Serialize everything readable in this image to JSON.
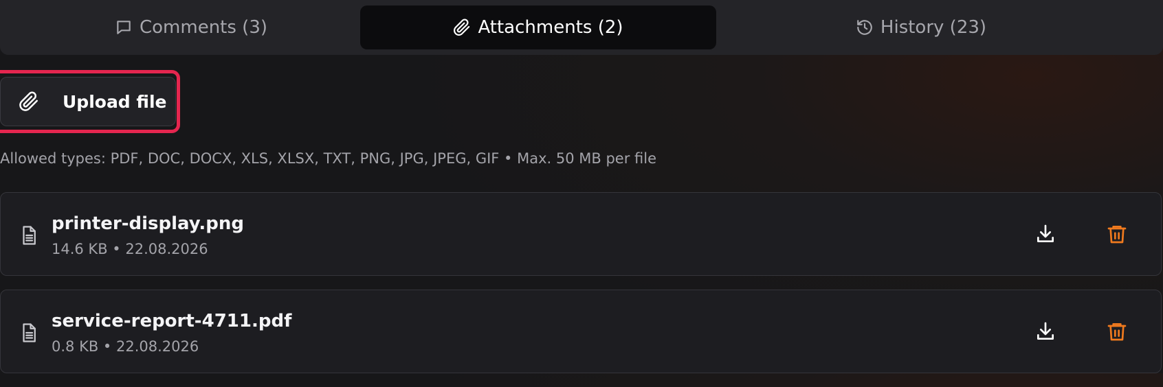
{
  "tabs": [
    {
      "label": "Comments (3)",
      "icon": "comment-icon",
      "active": false
    },
    {
      "label": "Attachments (2)",
      "icon": "paperclip-icon",
      "active": true
    },
    {
      "label": "History (23)",
      "icon": "history-icon",
      "active": false
    }
  ],
  "upload": {
    "label": "Upload file",
    "icon": "paperclip-icon",
    "highlight_color": "#e5264f"
  },
  "hint": "Allowed types: PDF, DOC, DOCX, XLS, XLSX, TXT, PNG, JPG, JPEG, GIF • Max. 50 MB per file",
  "files": [
    {
      "name": "printer-display.png",
      "meta": "14.6 KB • 22.08.2026",
      "icon": "file-text-icon"
    },
    {
      "name": "service-report-4711.pdf",
      "meta": "0.8 KB • 22.08.2026",
      "icon": "file-text-icon"
    }
  ],
  "actions": {
    "download_icon": "download-icon",
    "delete_icon": "trash-icon",
    "delete_color": "#f07a1e"
  }
}
